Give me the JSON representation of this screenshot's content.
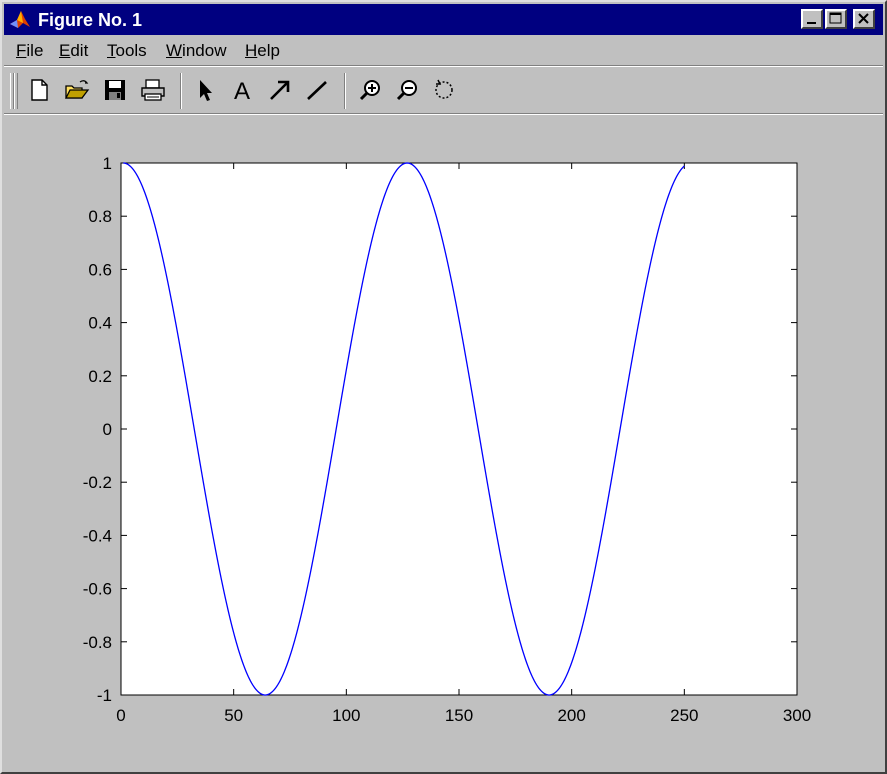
{
  "window": {
    "title": "Figure No. 1",
    "accent": "#000080",
    "face": "#c0c0c0"
  },
  "menu": [
    {
      "label": "File",
      "mnemonic": "F",
      "rest": "ile"
    },
    {
      "label": "Edit",
      "mnemonic": "E",
      "rest": "dit"
    },
    {
      "label": "Tools",
      "mnemonic": "T",
      "rest": "ools"
    },
    {
      "label": "Window",
      "mnemonic": "W",
      "rest": "indow"
    },
    {
      "label": "Help",
      "mnemonic": "H",
      "rest": "elp"
    }
  ],
  "toolbar": {
    "icons": [
      "new-figure-icon",
      "open-file-icon",
      "save-icon",
      "print-icon",
      "edit-plot-arrow-icon",
      "insert-text-icon",
      "insert-arrow-icon",
      "insert-line-icon",
      "zoom-in-icon",
      "zoom-out-icon",
      "rotate-3d-icon"
    ],
    "text_tool_glyph": "A"
  },
  "chart_data": {
    "type": "line",
    "title": "",
    "xlabel": "",
    "ylabel": "",
    "xlim": [
      0,
      300
    ],
    "ylim": [
      -1,
      1
    ],
    "xticks": [
      0,
      50,
      100,
      150,
      200,
      250,
      300
    ],
    "yticks": [
      -1,
      -0.8,
      -0.6,
      -0.4,
      -0.2,
      0,
      0.2,
      0.4,
      0.6,
      0.8,
      1
    ],
    "xtick_labels": [
      "0",
      "50",
      "100",
      "150",
      "200",
      "250",
      "300"
    ],
    "ytick_labels": [
      "-1",
      "-0.8",
      "-0.6",
      "-0.4",
      "-0.2",
      "0",
      "0.2",
      "0.4",
      "0.6",
      "0.8",
      "1"
    ],
    "grid": false,
    "series": [
      {
        "color": "#0000ff",
        "x_range": [
          1,
          250
        ],
        "function": "cos",
        "period": 126,
        "amplitude": 1,
        "points": [
          [
            1,
            1
          ],
          [
            32,
            0
          ],
          [
            64,
            -1
          ],
          [
            95,
            0
          ],
          [
            127,
            1
          ],
          [
            158,
            0
          ],
          [
            190,
            -1
          ],
          [
            221,
            0
          ],
          [
            250,
            0.99
          ]
        ]
      }
    ]
  }
}
